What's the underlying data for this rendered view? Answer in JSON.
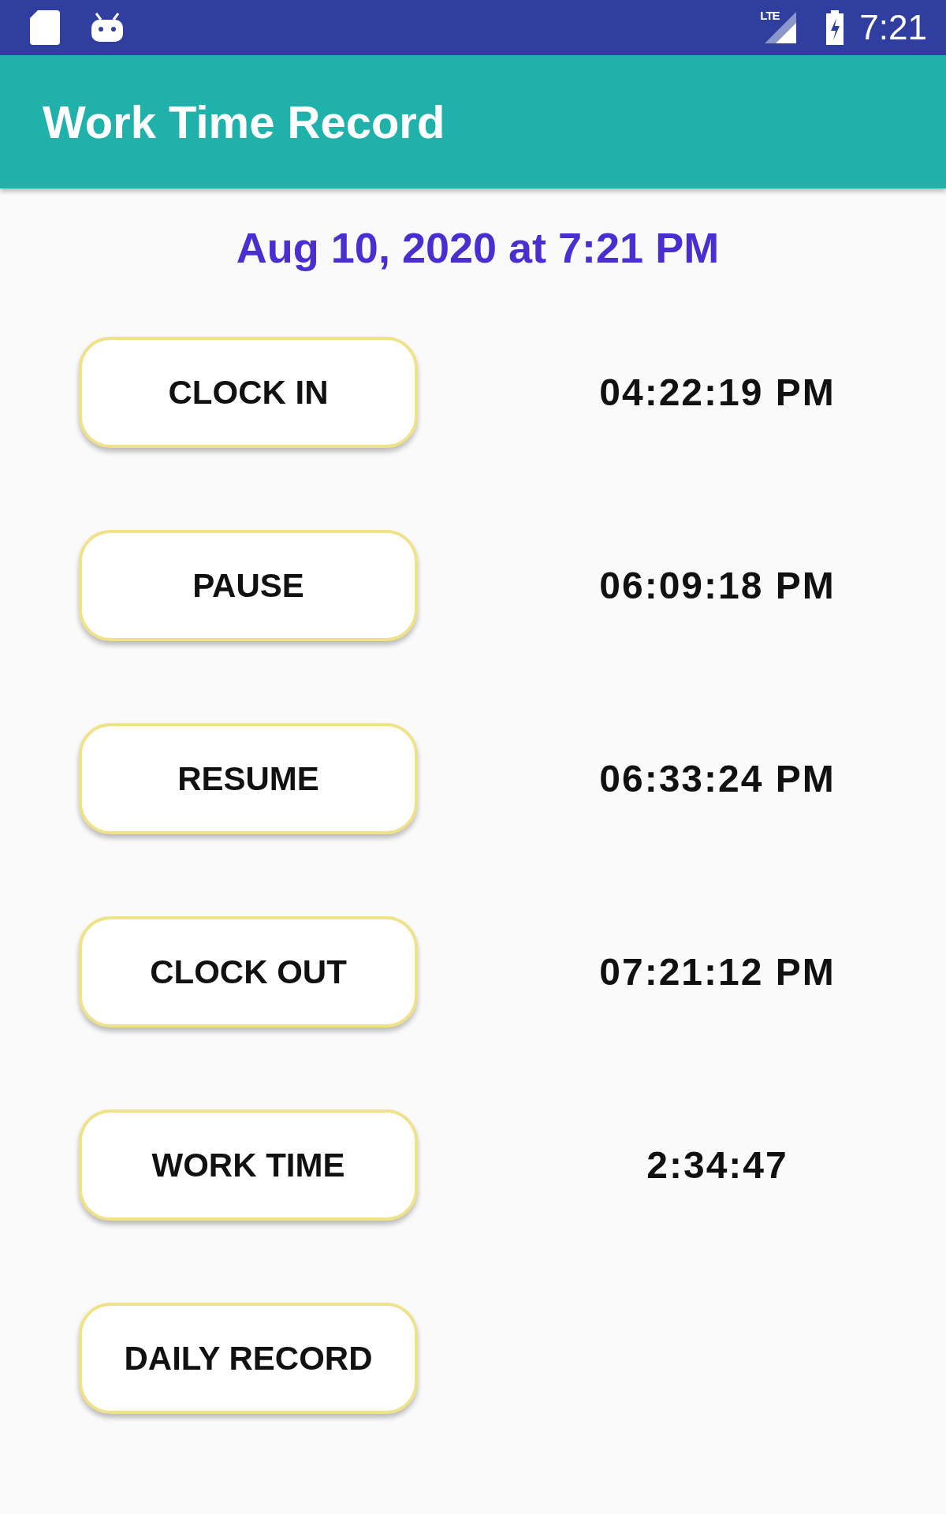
{
  "status_bar": {
    "network": "LTE",
    "time": "7:21"
  },
  "app_bar": {
    "title": "Work Time Record"
  },
  "date": "Aug 10, 2020 at 7:21 PM",
  "rows": [
    {
      "button": "CLOCK IN",
      "value": "04:22:19 PM"
    },
    {
      "button": "PAUSE",
      "value": "06:09:18 PM"
    },
    {
      "button": "RESUME",
      "value": "06:33:24 PM"
    },
    {
      "button": "CLOCK OUT",
      "value": "07:21:12 PM"
    },
    {
      "button": "WORK TIME",
      "value": "2:34:47"
    },
    {
      "button": "DAILY RECORD"
    }
  ]
}
